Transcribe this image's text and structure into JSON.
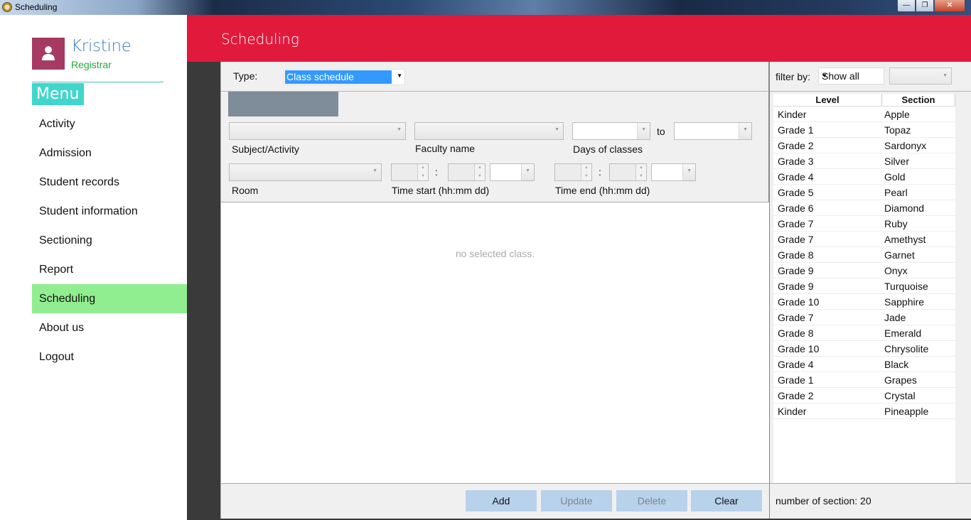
{
  "window": {
    "title": "Scheduling",
    "buttons": {
      "minimize": "—",
      "maximize": "❐",
      "close": "✕"
    }
  },
  "user": {
    "name": "Kristine",
    "role": "Registrar"
  },
  "sidebar": {
    "menu_label": "Menu",
    "items": [
      {
        "label": "Activity"
      },
      {
        "label": "Admission"
      },
      {
        "label": "Student records"
      },
      {
        "label": "Student information"
      },
      {
        "label": "Sectioning"
      },
      {
        "label": "Report"
      },
      {
        "label": "Scheduling",
        "active": true
      },
      {
        "label": "About us"
      },
      {
        "label": "Logout"
      }
    ]
  },
  "header": {
    "title": "Scheduling"
  },
  "form": {
    "type_label": "Type:",
    "type_value": "Class schedule",
    "subject_label": "Subject/Activity",
    "faculty_label": "Faculty name",
    "days_label": "Days of classes",
    "to_label": "to",
    "room_label": "Room",
    "time_start_label": "Time start (hh:mm dd)",
    "time_end_label": "Time end (hh:mm dd)",
    "colon": ":",
    "empty_message": "no selected class."
  },
  "actions": {
    "add": "Add",
    "update": "Update",
    "delete": "Delete",
    "clear": "Clear"
  },
  "filter": {
    "label": "filter by:",
    "value": "Show all",
    "secondary_value": ""
  },
  "grid": {
    "columns": [
      "Level",
      "Section"
    ],
    "rows": [
      [
        "Kinder",
        "Apple"
      ],
      [
        "Grade 1",
        "Topaz"
      ],
      [
        "Grade 2",
        "Sardonyx"
      ],
      [
        "Grade 3",
        "Silver"
      ],
      [
        "Grade 4",
        "Gold"
      ],
      [
        "Grade 5",
        "Pearl"
      ],
      [
        "Grade 6",
        "Diamond"
      ],
      [
        "Grade 7",
        "Ruby"
      ],
      [
        "Grade 7",
        "Amethyst"
      ],
      [
        "Grade 8",
        "Garnet"
      ],
      [
        "Grade 9",
        "Onyx"
      ],
      [
        "Grade 9",
        "Turquoise"
      ],
      [
        "Grade 10",
        "Sapphire"
      ],
      [
        "Grade 7",
        "Jade"
      ],
      [
        "Grade 8",
        "Emerald"
      ],
      [
        "Grade 10",
        "Chrysolite"
      ],
      [
        "Grade 4",
        "Black"
      ],
      [
        "Grade 1",
        "Grapes"
      ],
      [
        "Grade 2",
        "Crystal"
      ],
      [
        "Kinder",
        "Pineapple"
      ]
    ]
  },
  "footer": {
    "count_text": "number of section: 20"
  },
  "colors": {
    "header": "#e11a3c",
    "accent": "#40d6cc",
    "active_menu": "#90ee90",
    "avatar": "#a63a62",
    "button": "#b8d2ec"
  }
}
